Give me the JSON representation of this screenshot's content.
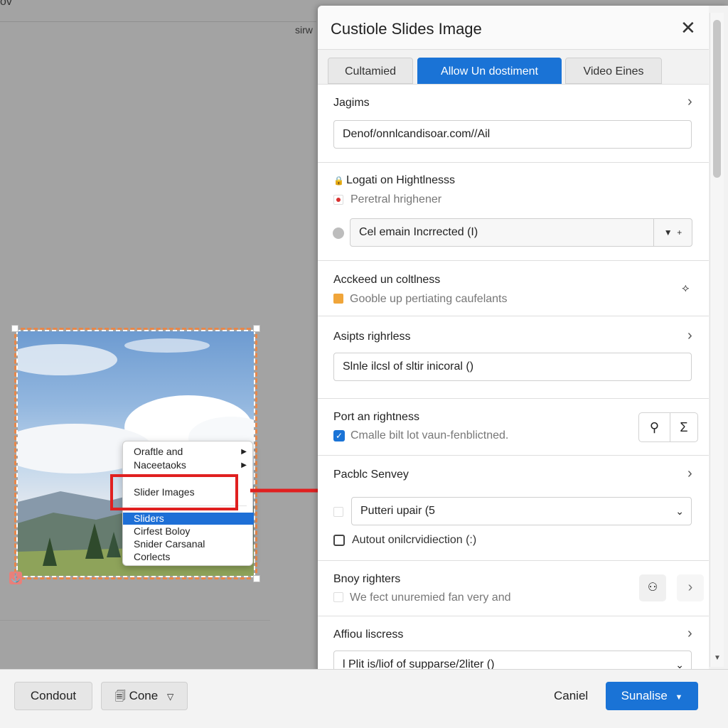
{
  "background": {
    "corner_text": "ov",
    "note_text": "sirw"
  },
  "context_menu": {
    "items": [
      {
        "label": "Oraftle and",
        "has_submenu": true
      },
      {
        "label": "Naceetaoks",
        "has_submenu": true
      },
      {
        "label": "Slider Images",
        "highlighted": true
      },
      {
        "label": "Sliders",
        "selected": true
      },
      {
        "label": "Cirfest Boloy"
      },
      {
        "label": "Snider Carsanal"
      },
      {
        "label": "Corlects"
      }
    ]
  },
  "dialog": {
    "title": "Custiole Slides Image",
    "tabs": [
      {
        "label": "Cultamied",
        "active": false
      },
      {
        "label": "Allow Un dostiment",
        "active": true
      },
      {
        "label": "Video Eines",
        "active": false
      }
    ],
    "sections": {
      "jagims": {
        "title": "Jagims",
        "field_value": "Denof/onnlcandisoar.com//Ail"
      },
      "location": {
        "title": "Logati on Hightlnesss",
        "sub": "Peretral hrighener",
        "select_value": "Cel emain Incrrected (I)"
      },
      "acckeed": {
        "title": "Acckeed un coltlness",
        "sub": "Gooble up pertiating caufelants"
      },
      "asipts": {
        "title": "Asipts righrless",
        "field_value": "Slnle ilcsl of sltir inicoral ()"
      },
      "port": {
        "title": "Port an rightness",
        "checkbox_label": "Cmalle bilt lot vaun-fenblictned.",
        "checked": true
      },
      "pacbic": {
        "title": "Pacblc Senvey",
        "select_value": "Putteri upair (5",
        "checkbox_label": "Autout onilcrvidiection (:)",
        "checked": false
      },
      "bnoy": {
        "title": "Bnoy righters",
        "sub": "We fect unuremied fan very and"
      },
      "affiou": {
        "title": "Affiou liscress",
        "field_value": "l Plit is/liof of supparse/2liter ()"
      }
    }
  },
  "footer": {
    "condout_label": "Condout",
    "cone_label": "Cone",
    "cancel_label": "Caniel",
    "submit_label": "Sunalise"
  },
  "colors": {
    "accent": "#1a73d6",
    "highlight_red": "#e02020",
    "selection_orange": "#e8874a"
  }
}
